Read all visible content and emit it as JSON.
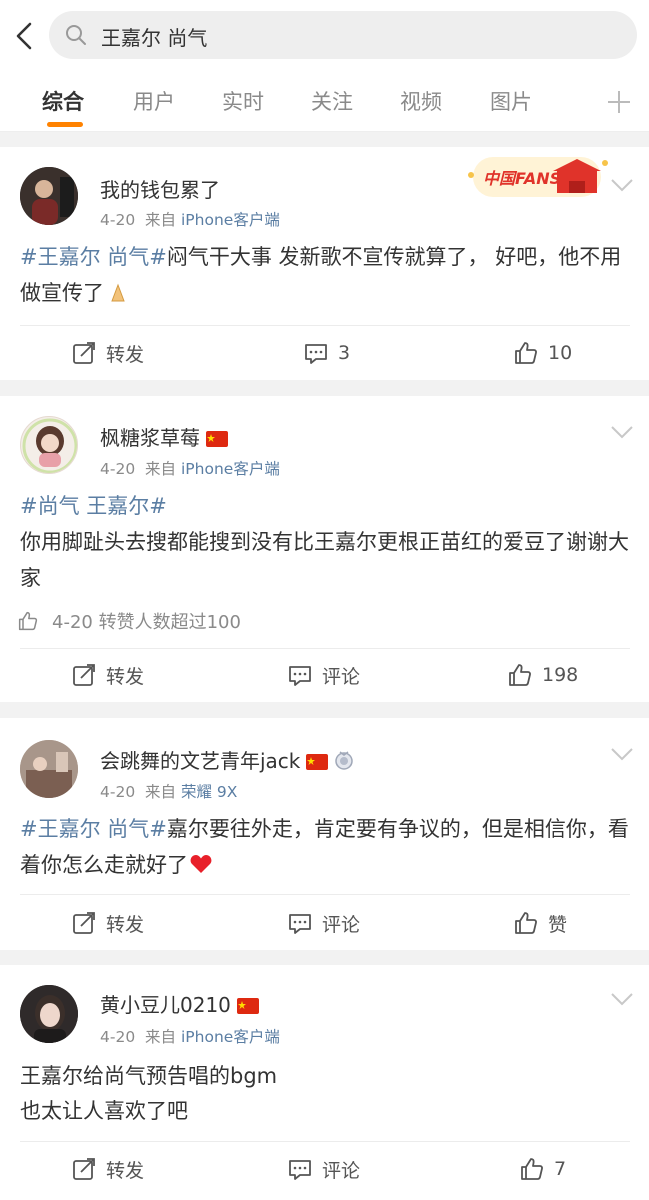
{
  "search": {
    "query": "王嘉尔 尚气"
  },
  "tabs": [
    "综合",
    "用户",
    "实时",
    "关注",
    "视频",
    "图片"
  ],
  "actions": {
    "repost": "转发",
    "comment": "评论",
    "like": "赞"
  },
  "posts": [
    {
      "username": "我的钱包累了",
      "date": "4-20",
      "from": "来自",
      "source": "iPhone客户端",
      "badge": "中国FANS",
      "tag": "#王嘉尔 尚气#",
      "body": "闷气干大事 发新歌不宣传就算了， 好吧，他不用做宣传了",
      "comment_count": "3",
      "like_count": "10"
    },
    {
      "username": "枫糖浆草莓",
      "date": "4-20",
      "from": "来自",
      "source": "iPhone客户端",
      "tag": "#尚气 王嘉尔#",
      "body": "你用脚趾头去搜都能搜到没有比王嘉尔更根正苗红的爱豆了谢谢大家",
      "like_line": "4-20 转赞人数超过100",
      "comment_count": "评论",
      "like_count": "198"
    },
    {
      "username": "会跳舞的文艺青年jack",
      "date": "4-20",
      "from": "来自",
      "source": "荣耀 9X",
      "tag": "#王嘉尔 尚气#",
      "body": "嘉尔要往外走，肯定要有争议的，但是相信你，看着你怎么走就好了",
      "comment_count": "评论",
      "like_count": "赞"
    },
    {
      "username": "黄小豆儿0210",
      "date": "4-20",
      "from": "来自",
      "source": "iPhone客户端",
      "body_line1": "王嘉尔给尚气预告唱的bgm",
      "body_line2": "也太让人喜欢了吧",
      "comment_count": "评论",
      "like_count": "7"
    }
  ],
  "colors": {
    "accent": "#ff8200",
    "link": "#5b7ea3",
    "text": "#333333",
    "muted": "#8a8a8a"
  }
}
